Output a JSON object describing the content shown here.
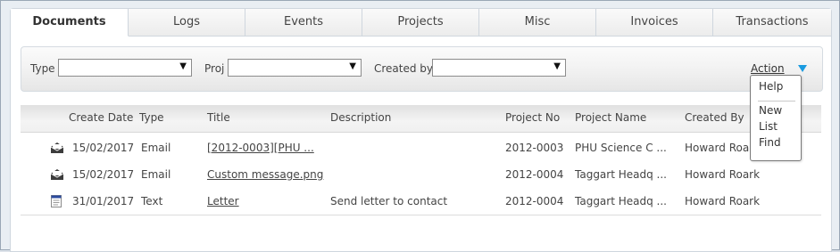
{
  "tabs": [
    "Documents",
    "Logs",
    "Events",
    "Projects",
    "Misc",
    "Invoices",
    "Transactions"
  ],
  "filters": {
    "type_label": "Type",
    "proj_label": "Proj",
    "created_by_label": "Created by",
    "type_value": "",
    "proj_value": "",
    "created_by_value": ""
  },
  "action": {
    "label": "Action",
    "menu": [
      "Help",
      "New",
      "List",
      "Find"
    ]
  },
  "table": {
    "columns": [
      "Create Date",
      "Type",
      "Title",
      "Description",
      "Project No",
      "Project Name",
      "Created By"
    ],
    "rows": [
      {
        "icon": "email-icon",
        "date": "15/02/2017",
        "type": "Email",
        "title": "[2012-0003][PHU ...",
        "description": "",
        "project_no": "2012-0003",
        "project_name": "PHU Science C ...",
        "created_by": "Howard Roark"
      },
      {
        "icon": "email-icon",
        "date": "15/02/2017",
        "type": "Email",
        "title": "Custom message.png",
        "description": "",
        "project_no": "2012-0004",
        "project_name": "Taggart Headq ...",
        "created_by": "Howard Roark"
      },
      {
        "icon": "text-document-icon",
        "date": "31/01/2017",
        "type": "Text",
        "title": "Letter",
        "description": "Send letter to contact",
        "project_no": "2012-0004",
        "project_name": "Taggart Headq ...",
        "created_by": "Howard Roark"
      }
    ]
  },
  "colors": {
    "accent_arrow": "#1a9be0"
  }
}
